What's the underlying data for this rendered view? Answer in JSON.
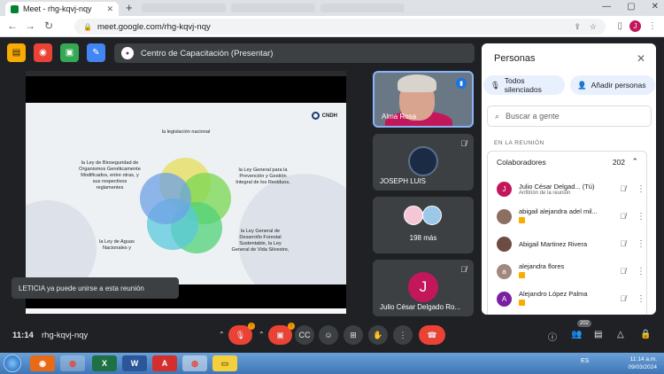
{
  "browser": {
    "tab_title": "Meet - rhg-kqvj-nqy",
    "tab_close": "✕",
    "new_tab": "+",
    "url": "meet.google.com/rhg-kqvj-nqy",
    "profile_initial": "J",
    "win_controls": [
      "—",
      "▢",
      "✕"
    ]
  },
  "meeting": {
    "presenter_title": "Centro de Capacitación (Presentar)",
    "code": "rhg-kqvj-nqy",
    "time": "11:14"
  },
  "slide": {
    "logo": "CNDH",
    "labels": {
      "top": "la legislación nacional",
      "left": "la Ley de Bioseguridad de Organismos Genéticamente Modificados, entre otras, y sus respectivos reglamentes",
      "right": "la Ley General para la Prevención y Gestión Integral de los Residuos,",
      "bottom_left": "la Ley de Aguas Nacionales y",
      "bottom_right": "la Ley General de Desarrollo Forestal Sustentable, la Ley General de Vida Silvestre,"
    }
  },
  "tiles": [
    {
      "name": "Alma Rosa"
    },
    {
      "name": "JOSEPH LUIS"
    },
    {
      "name": "198 más"
    },
    {
      "name": "Julio César Delgado Ro...",
      "initial": "J"
    }
  ],
  "toast": "LETICIA ya puede unirse a esta reunión",
  "controls": {
    "participant_count": "202"
  },
  "people_panel": {
    "title": "Personas",
    "mute_all": "Todos silenciados",
    "add_people": "Añadir personas",
    "search_placeholder": "Buscar a gente",
    "section": "EN LA REUNIÓN",
    "group_name": "Colaboradores",
    "group_count": "202",
    "people": [
      {
        "name": "Julio César Delgad... (Tú)",
        "sub": "Anfitrión de la reunión",
        "initial": "J",
        "color": "#c2185b"
      },
      {
        "name": "abigail alejandra adel mil...",
        "sub": "",
        "initial": "",
        "color": "#8d6e63"
      },
      {
        "name": "Abigail Martinez Rivera",
        "sub": "",
        "initial": "",
        "color": "#6d4c41"
      },
      {
        "name": "alejandra flores",
        "sub": "",
        "initial": "a",
        "color": "#a1887f"
      },
      {
        "name": "Alejandro López Palma",
        "sub": "",
        "initial": "A",
        "color": "#7b1fa2"
      }
    ]
  },
  "taskbar": {
    "lang": "ES",
    "clock": "11:14 a.m.",
    "date": "09/03/2024",
    "word_letter": "W"
  }
}
